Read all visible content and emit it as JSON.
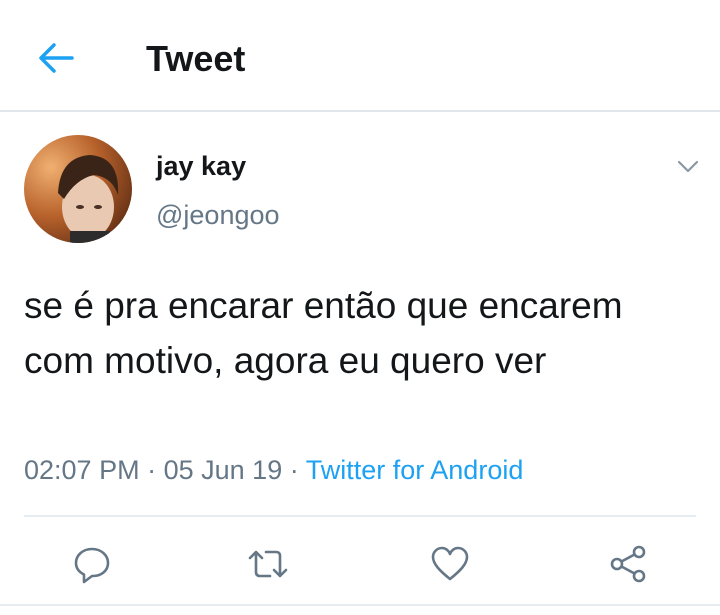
{
  "header": {
    "title": "Tweet",
    "back_icon": "arrow-left-icon",
    "accent": "#1da1f2"
  },
  "tweet": {
    "display_name": "jay kay",
    "handle": "@jeongoo",
    "text": "se é pra encarar então que encarem com motivo, agora eu quero ver",
    "time": "02:07 PM",
    "date": "05 Jun 19",
    "separator": "·",
    "source": "Twitter for Android"
  },
  "actions": [
    {
      "name": "reply",
      "icon": "speech-bubble-icon"
    },
    {
      "name": "retweet",
      "icon": "retweet-icon"
    },
    {
      "name": "like",
      "icon": "heart-icon"
    },
    {
      "name": "share",
      "icon": "share-icon"
    }
  ],
  "colors": {
    "text": "#14171a",
    "secondary": "#657786",
    "link": "#1da1f2",
    "icon": "#657786"
  }
}
